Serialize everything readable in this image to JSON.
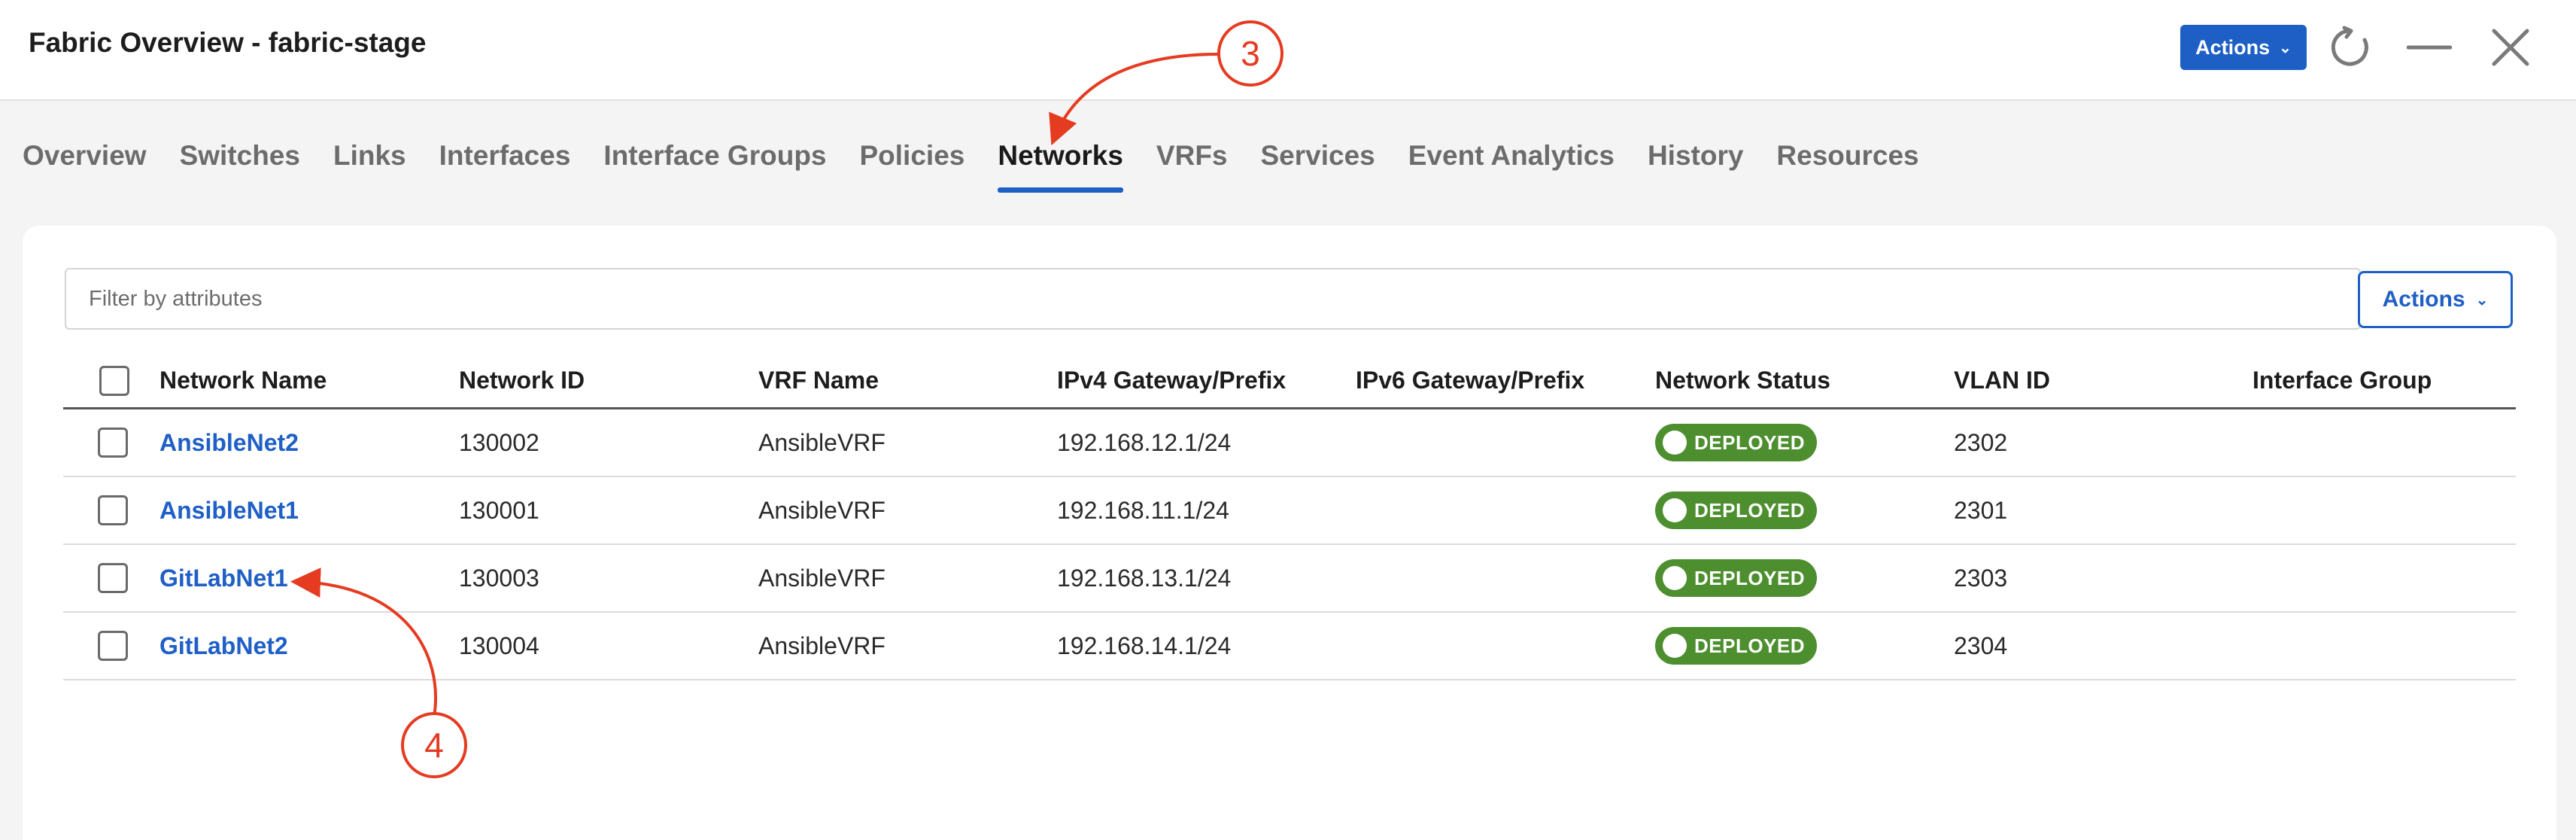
{
  "window": {
    "title": "Fabric Overview - fabric-stage",
    "actions_label": "Actions",
    "icons": [
      "refresh-icon",
      "minimize-icon",
      "close-icon"
    ]
  },
  "tabs": [
    {
      "label": "Overview",
      "active": false
    },
    {
      "label": "Switches",
      "active": false
    },
    {
      "label": "Links",
      "active": false
    },
    {
      "label": "Interfaces",
      "active": false
    },
    {
      "label": "Interface Groups",
      "active": false
    },
    {
      "label": "Policies",
      "active": false
    },
    {
      "label": "Networks",
      "active": true
    },
    {
      "label": "VRFs",
      "active": false
    },
    {
      "label": "Services",
      "active": false
    },
    {
      "label": "Event Analytics",
      "active": false
    },
    {
      "label": "History",
      "active": false
    },
    {
      "label": "Resources",
      "active": false
    }
  ],
  "toolbar": {
    "filter_placeholder": "Filter by attributes",
    "actions_label": "Actions"
  },
  "table": {
    "columns": [
      "Network Name",
      "Network ID",
      "VRF Name",
      "IPv4 Gateway/Prefix",
      "IPv6 Gateway/Prefix",
      "Network Status",
      "VLAN ID",
      "Interface Group"
    ],
    "rows": [
      {
        "name": "AnsibleNet2",
        "id": "130002",
        "vrf": "AnsibleVRF",
        "ipv4": "192.168.12.1/24",
        "ipv6": "",
        "status": "DEPLOYED",
        "vlan": "2302",
        "group": ""
      },
      {
        "name": "AnsibleNet1",
        "id": "130001",
        "vrf": "AnsibleVRF",
        "ipv4": "192.168.11.1/24",
        "ipv6": "",
        "status": "DEPLOYED",
        "vlan": "2301",
        "group": ""
      },
      {
        "name": "GitLabNet1",
        "id": "130003",
        "vrf": "AnsibleVRF",
        "ipv4": "192.168.13.1/24",
        "ipv6": "",
        "status": "DEPLOYED",
        "vlan": "2303",
        "group": ""
      },
      {
        "name": "GitLabNet2",
        "id": "130004",
        "vrf": "AnsibleVRF",
        "ipv4": "192.168.14.1/24",
        "ipv6": "",
        "status": "DEPLOYED",
        "vlan": "2304",
        "group": ""
      }
    ]
  },
  "annotations": {
    "step3": "3",
    "step4": "4"
  },
  "colors": {
    "accent": "#1e5fc6",
    "status_deployed": "#4d8f2f",
    "annotation": "#e53b21"
  }
}
